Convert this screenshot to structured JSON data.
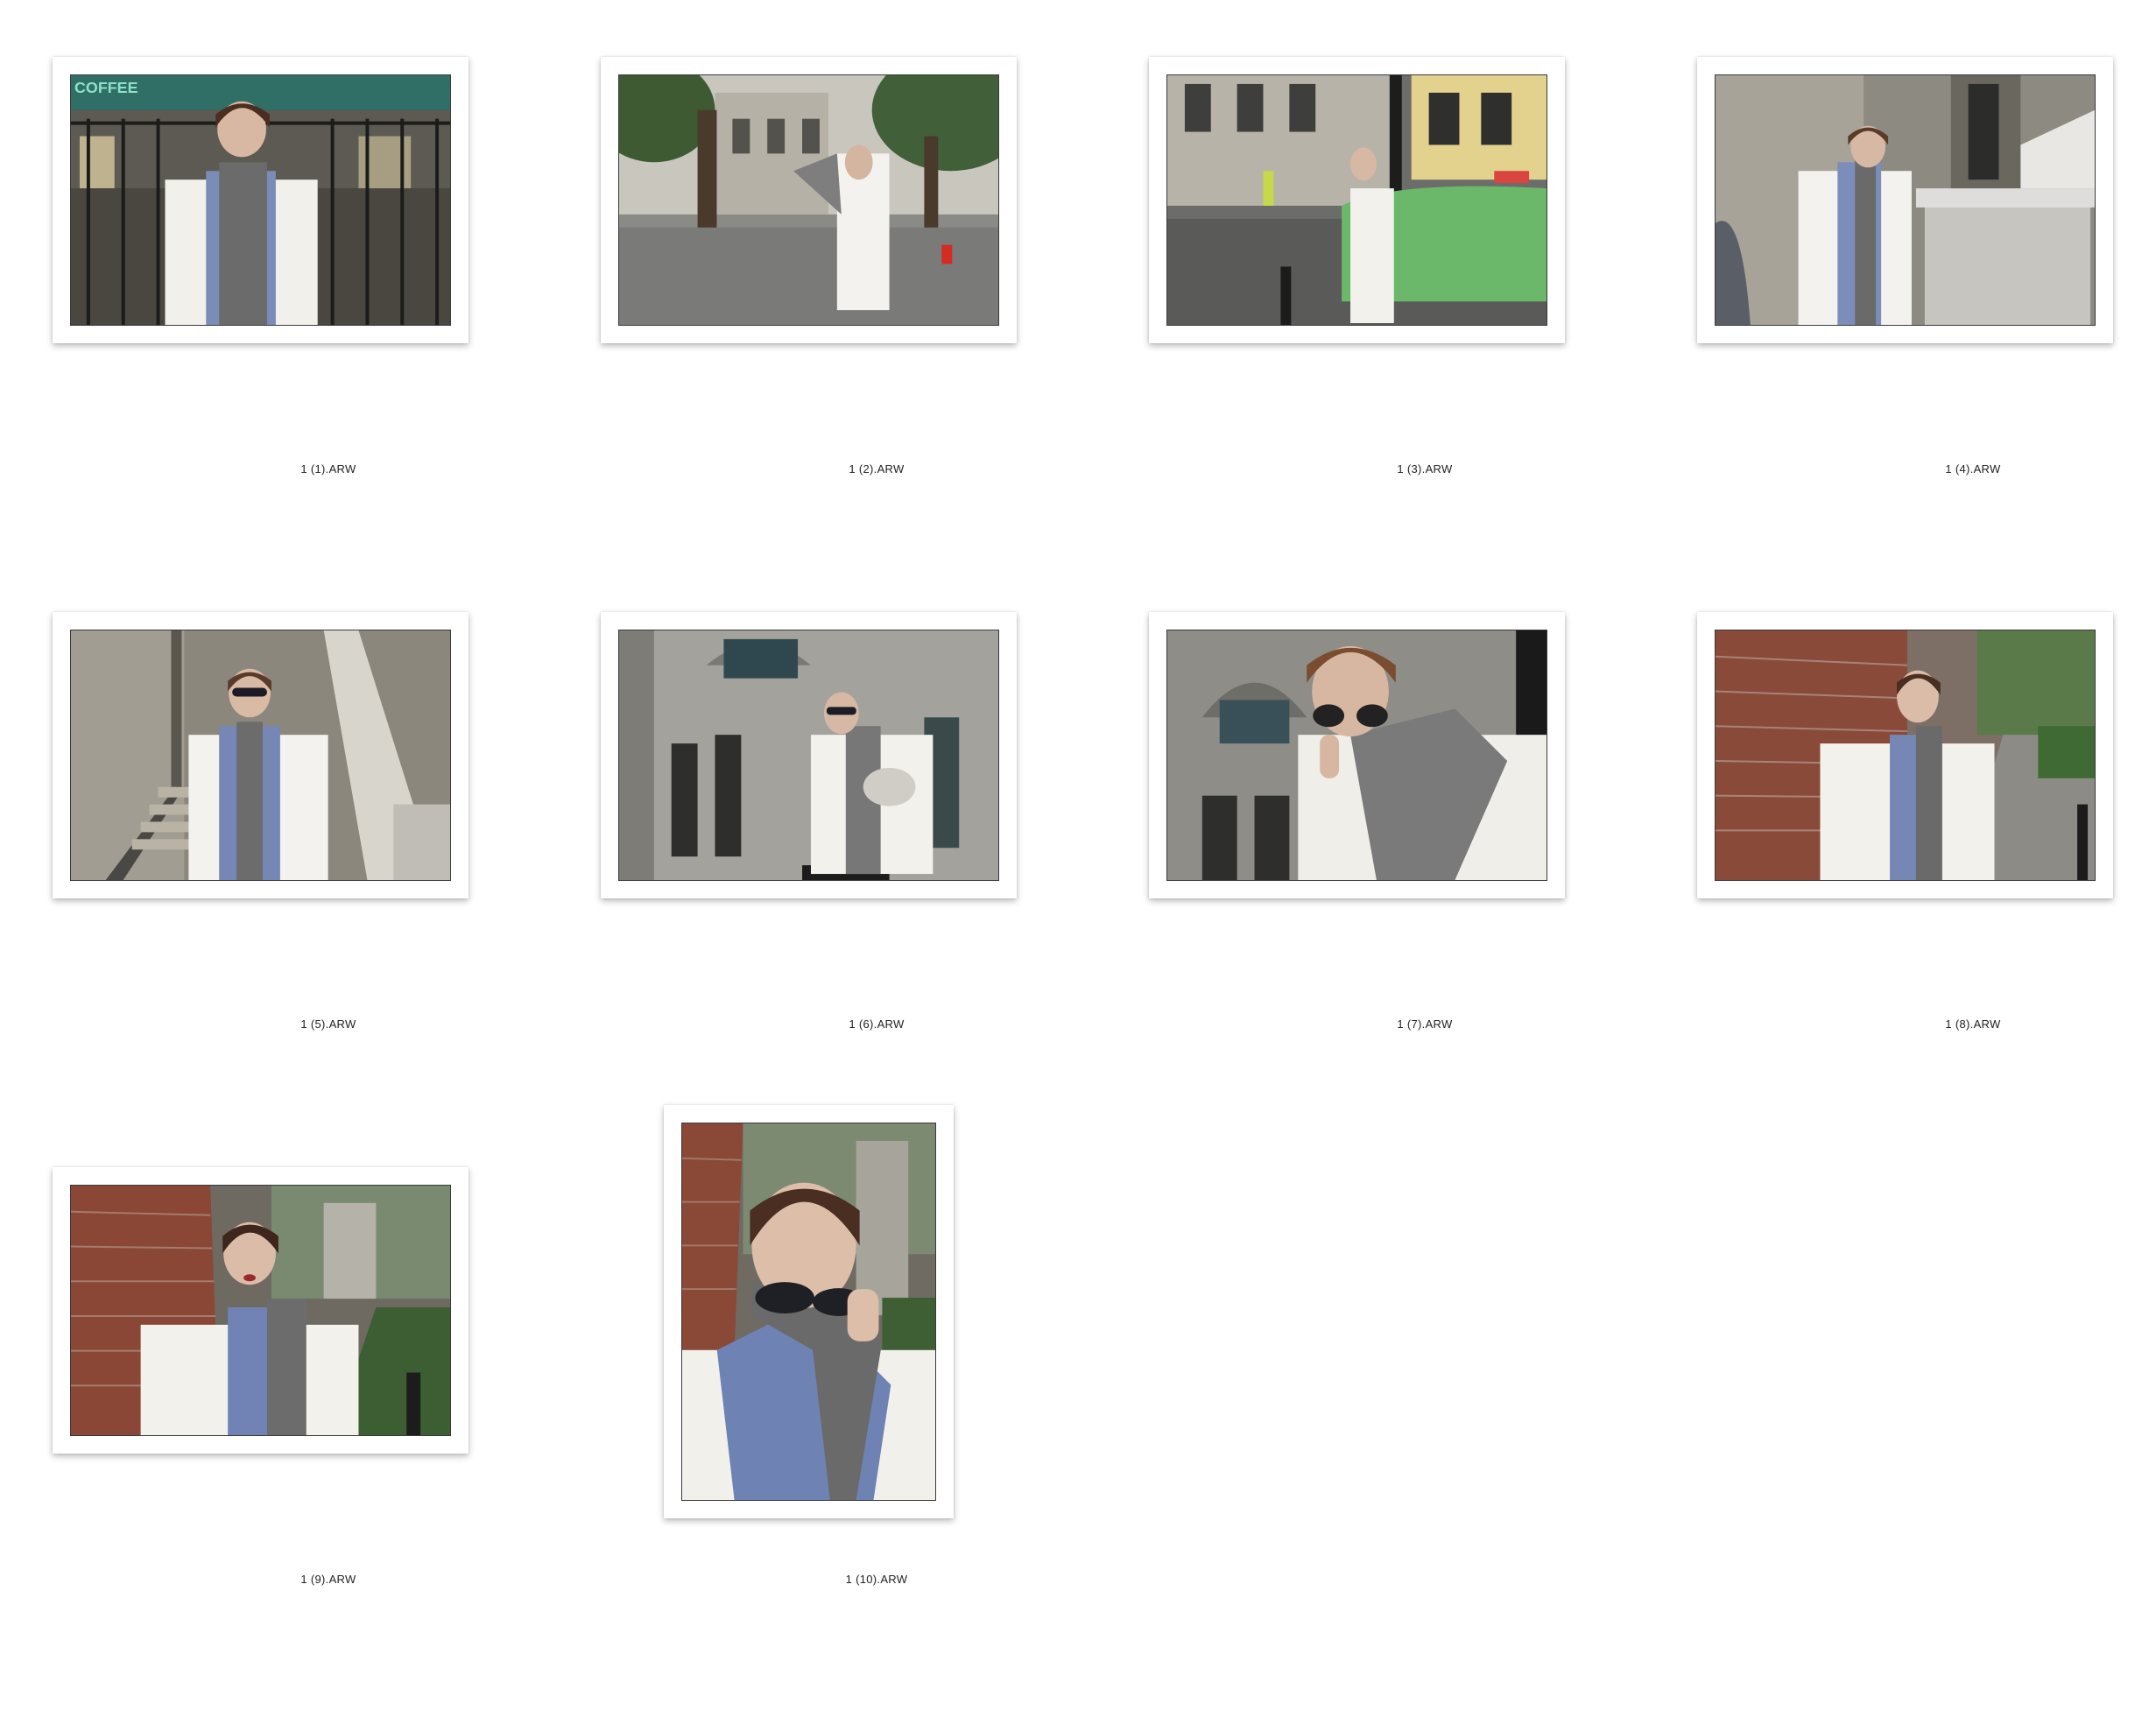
{
  "window": {
    "title": ""
  },
  "photos": [
    {
      "filename": "1 (1).ARW",
      "orientation": "landscape",
      "scene": "cafe-fence",
      "sign_text": "COFFEE"
    },
    {
      "filename": "1 (2).ARW",
      "orientation": "landscape",
      "scene": "street-trees"
    },
    {
      "filename": "1 (3).ARW",
      "orientation": "landscape",
      "scene": "street-taxi"
    },
    {
      "filename": "1 (4).ARW",
      "orientation": "landscape",
      "scene": "stone-stairs"
    },
    {
      "filename": "1 (5).ARW",
      "orientation": "landscape",
      "scene": "stairway"
    },
    {
      "filename": "1 (6).ARW",
      "orientation": "landscape",
      "scene": "classical-building"
    },
    {
      "filename": "1 (7).ARW",
      "orientation": "landscape",
      "scene": "closeup-sunglasses"
    },
    {
      "filename": "1 (8).ARW",
      "orientation": "landscape",
      "scene": "brick-wall"
    },
    {
      "filename": "1 (9).ARW",
      "orientation": "landscape",
      "scene": "brick-wall-closeup"
    },
    {
      "filename": "1 (10).ARW",
      "orientation": "portrait",
      "scene": "portrait-sunglasses"
    }
  ],
  "colors": {
    "background": "#ffffff",
    "frame": "#ffffff",
    "label": "#222222"
  }
}
